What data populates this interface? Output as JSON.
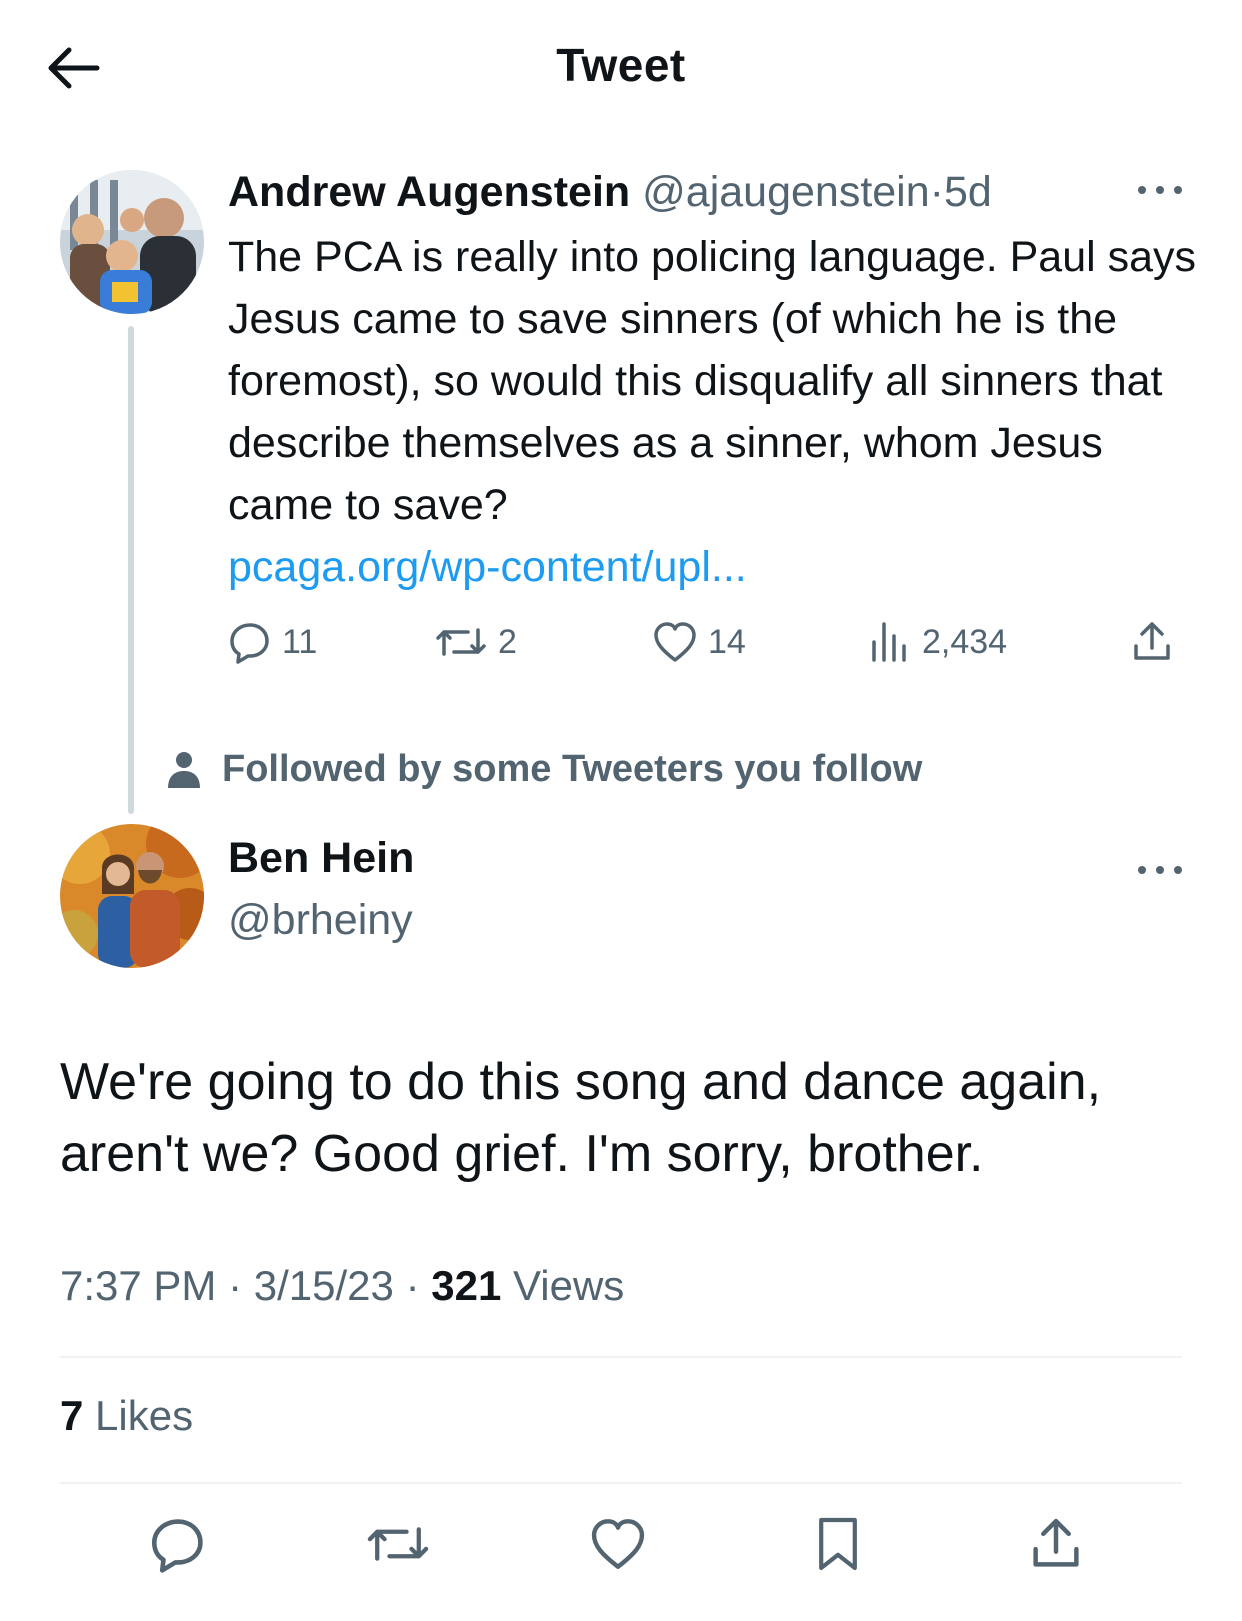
{
  "header": {
    "title": "Tweet",
    "back_icon": "arrow-left-icon"
  },
  "parent_tweet": {
    "author_name": "Andrew Augenstein",
    "author_handle": "@ajaugenstein",
    "separator": "·",
    "time_ago": "5d",
    "text": "The PCA is really into policing language. Paul says Jesus came to save sinners (of which he is the foremost), so would this disqualify all sinners that describe themselves as a sinner, whom Jesus came to save?",
    "link": "pcaga.org/wp-content/upl...",
    "stats": {
      "replies": "11",
      "retweets": "2",
      "likes": "14",
      "views": "2,434"
    }
  },
  "social_context": {
    "text": "Followed by some Tweeters you follow",
    "icon": "person-icon"
  },
  "main_tweet": {
    "author_name": "Ben Hein",
    "author_handle": "@brheiny",
    "text": "We're going to do this song and dance again, aren't we? Good grief. I'm sorry, brother.",
    "time": "7:37 PM",
    "date": "3/15/23",
    "separator": "·",
    "views_count": "321",
    "views_label": "Views",
    "likes_count": "7",
    "likes_label": "Likes"
  },
  "colors": {
    "link": "#1d9bf0",
    "secondary_text": "#536471",
    "primary_text": "#0f1419",
    "thread_line": "#cfd9de"
  }
}
